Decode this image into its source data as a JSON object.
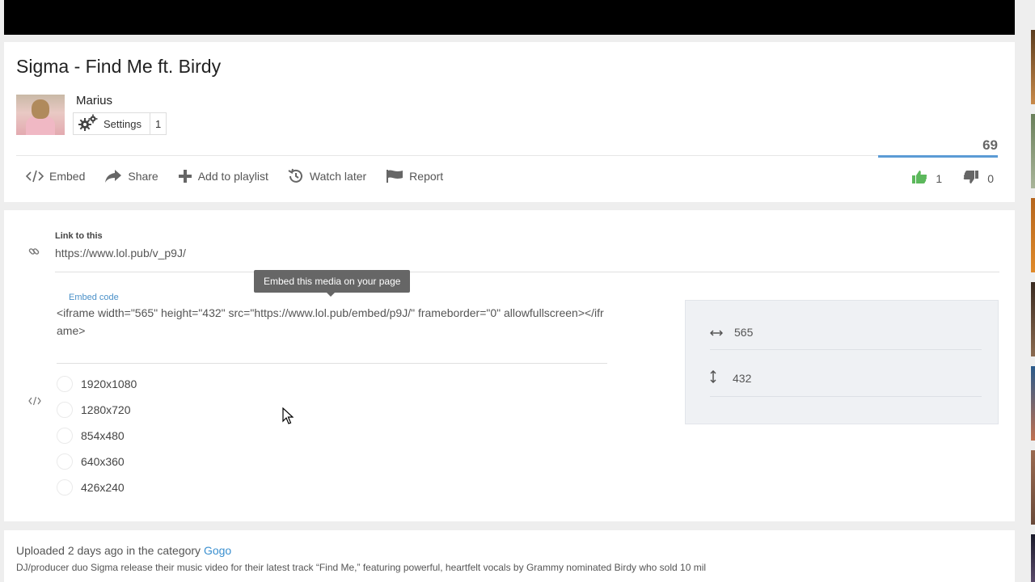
{
  "video": {
    "title": "Sigma - Find Me ft. Birdy",
    "views": "69"
  },
  "channel": {
    "name": "Marius",
    "settings_label": "Settings",
    "settings_count": "1"
  },
  "actions": {
    "embed": "Embed",
    "share": "Share",
    "add_to_playlist": "Add to playlist",
    "watch_later": "Watch later",
    "report": "Report"
  },
  "votes": {
    "likes": "1",
    "dislikes": "0",
    "like_ratio": 1.0
  },
  "link": {
    "label": "Link to this",
    "url": "https://www.lol.pub/v_p9J/"
  },
  "embed": {
    "tooltip": "Embed this media on your page",
    "label": "Embed code",
    "code": "<iframe width=\"565\" height=\"432\" src=\"https://www.lol.pub/embed/p9J/\" frameborder=\"0\" allowfullscreen></iframe>",
    "sizes": [
      "1920x1080",
      "1280x720",
      "854x480",
      "640x360",
      "426x240"
    ],
    "width": "565",
    "height": "432"
  },
  "description": {
    "uploaded_prefix": "Uploaded 2 days ago in the category",
    "category": "Gogo",
    "text": "DJ/producer duo Sigma release their music video for their latest track “Find Me,” featuring powerful, heartfelt vocals by Grammy nominated Birdy who sold 10 mil"
  },
  "colors": {
    "accent": "#5b9bd5",
    "like": "#5cb85c",
    "link": "#3a8fcf"
  }
}
